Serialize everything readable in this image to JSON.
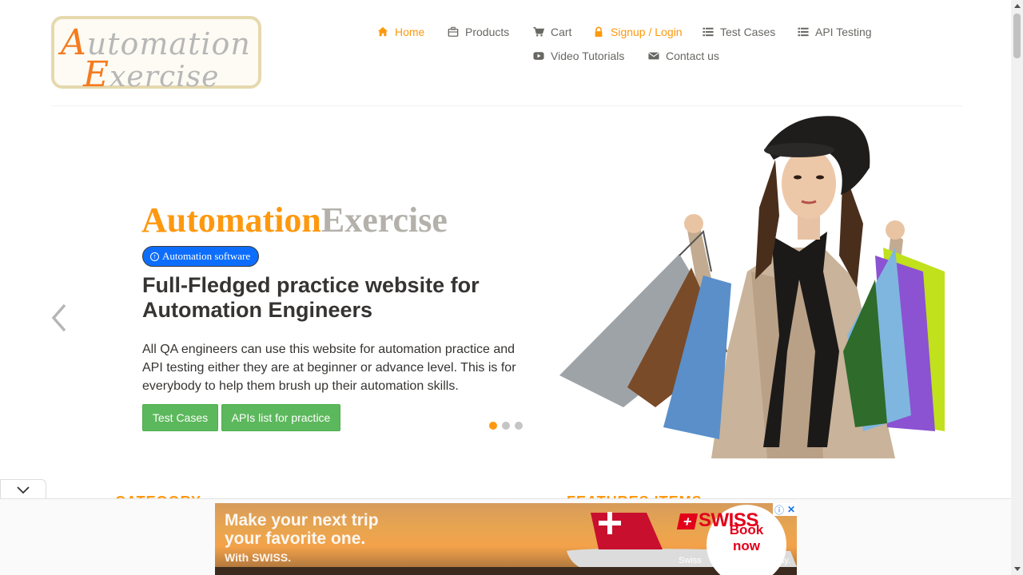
{
  "logo": {
    "line1_cap": "A",
    "line1_rest": "utomation",
    "line2_cap": "E",
    "line2_rest": "xercise"
  },
  "nav": {
    "items": [
      {
        "label": "Home",
        "icon": "home-icon"
      },
      {
        "label": "Products",
        "icon": "products-icon"
      },
      {
        "label": "Cart",
        "icon": "cart-icon"
      },
      {
        "label": "Signup / Login",
        "icon": "lock-icon"
      },
      {
        "label": "Test Cases",
        "icon": "list-icon"
      },
      {
        "label": "API Testing",
        "icon": "list-icon"
      },
      {
        "label": "Video Tutorials",
        "icon": "youtube-icon"
      },
      {
        "label": "Contact us",
        "icon": "envelope-icon"
      }
    ]
  },
  "hero": {
    "brand_a": "Automation",
    "brand_b": "Exercise",
    "badge": "Automation software",
    "title": "Full-Fledged practice website for Automation Engineers",
    "text": "All QA engineers can use this website for automation practice and API testing either they are at beginner or advance level. This is for everybody to help them brush up their automation skills.",
    "btn_test_cases": "Test Cases",
    "btn_apis": "APIs list for practice",
    "active_slide": 1,
    "slide_count": 3
  },
  "sections": {
    "category": "CATEGORY",
    "features": "FEATURES ITEMS"
  },
  "ad": {
    "headline_1": "Make your next trip",
    "headline_2": "your favorite one.",
    "sub": "With SWISS.",
    "brand": "SWISS",
    "book_1": "Book",
    "book_2": "now",
    "tagline": "Swiss all the way."
  },
  "colors": {
    "accent": "#fe980f",
    "button": "#5cb85c",
    "badge": "#0d6efd",
    "swiss_red": "#e2001a"
  }
}
